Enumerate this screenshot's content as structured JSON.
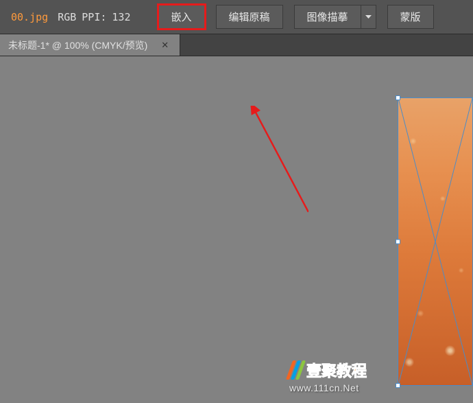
{
  "topbar": {
    "filename": "00.jpg",
    "color_mode": "RGB",
    "ppi_label": "PPI:",
    "ppi_value": "132",
    "buttons": {
      "embed": "嵌入",
      "edit_original": "编辑原稿",
      "image_trace": "图像描摹",
      "mask": "蒙版"
    }
  },
  "tabs": {
    "active": {
      "label": "未标题-1* @ 100% (CMYK/预览)"
    }
  },
  "watermark": {
    "brand": "壹聚教程",
    "url": "www.111cn.Net"
  }
}
